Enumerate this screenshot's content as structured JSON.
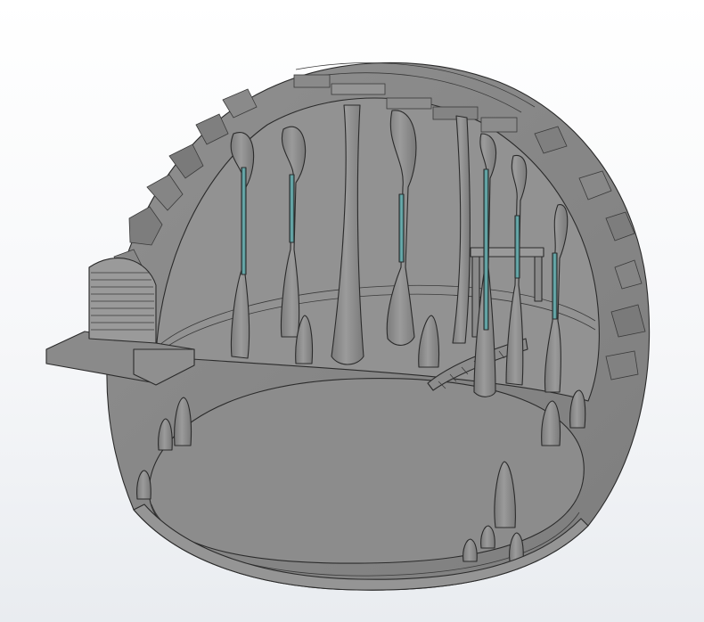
{
  "view": {
    "background_top": "#ffffff",
    "background_bottom": "#e9ecf0"
  },
  "model": {
    "description_icon": "cutaway-dome-model-icon",
    "colors": {
      "body": "#8a8a8a",
      "body_light": "#969696",
      "body_dark": "#6f6f6f",
      "floor": "#8c8c8c",
      "highlight_rod": "#4f8f91",
      "edge": "#2b2b2b"
    },
    "highlighted_rod_count": 6,
    "column_count": 18
  }
}
